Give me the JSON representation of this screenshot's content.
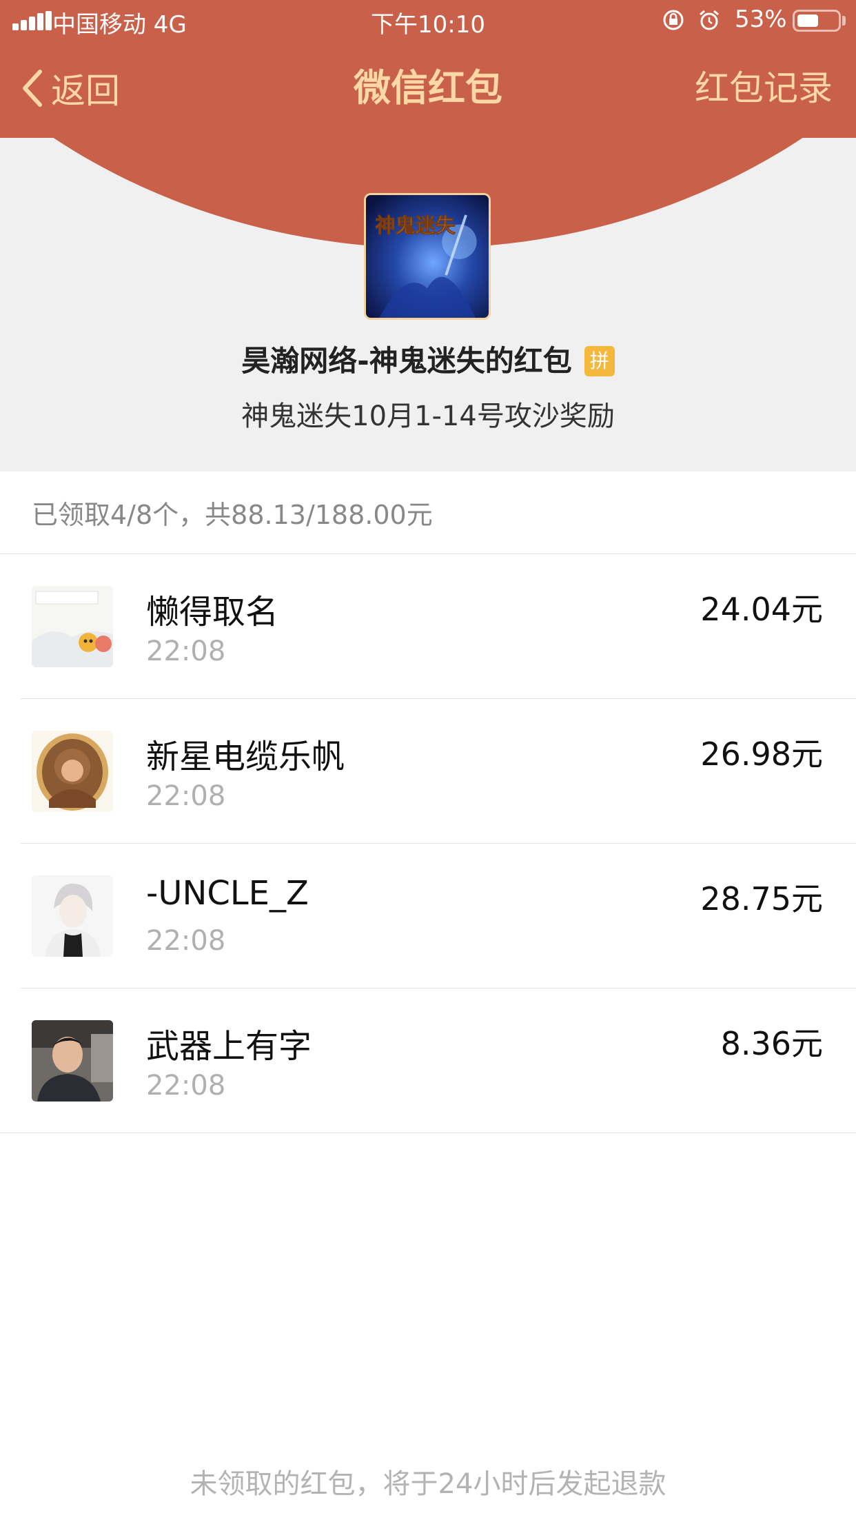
{
  "status_bar": {
    "carrier": "中国移动  4G",
    "time": "下午10:10",
    "battery_text": "53%",
    "battery_level": 0.53
  },
  "nav": {
    "back_label": "返回",
    "title": "微信红包",
    "right_label": "红包记录"
  },
  "packet": {
    "avatar_text": "神鬼迷失",
    "sender_title": "昊瀚网络-神鬼迷失的红包",
    "type_badge": "拼",
    "greeting": "神鬼迷失10月1-14号攻沙奖励"
  },
  "summary": {
    "text": "已领取4/8个，共88.13/188.00元"
  },
  "receivers": [
    {
      "name": "懒得取名",
      "time": "22:08",
      "amount": "24.04元"
    },
    {
      "name": "新星电缆乐帆",
      "time": "22:08",
      "amount": "26.98元"
    },
    {
      "name": "-UNCLE_Z",
      "time": "22:08",
      "amount": "28.75元"
    },
    {
      "name": "武器上有字",
      "time": "22:08",
      "amount": "8.36元"
    }
  ],
  "footer": {
    "note": "未领取的红包，将于24小时后发起退款"
  },
  "colors": {
    "header_red": "#c9604a",
    "header_text": "#fbd8a6",
    "badge_yellow": "#f4b93c"
  }
}
